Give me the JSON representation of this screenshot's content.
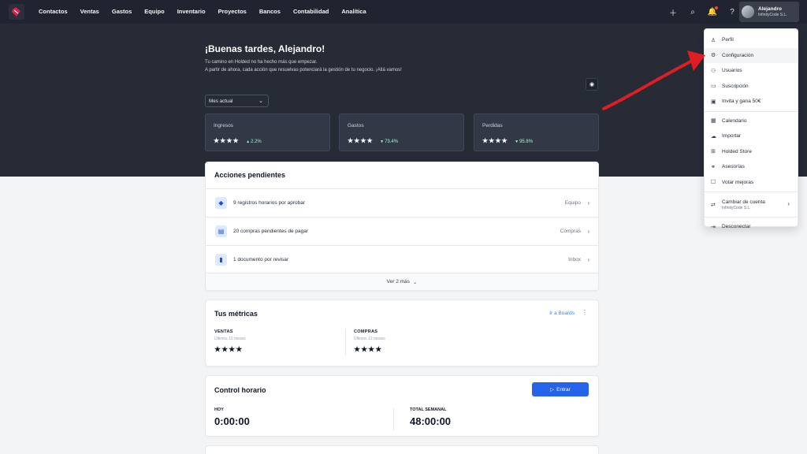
{
  "nav": {
    "items": [
      "Contactos",
      "Ventas",
      "Gastos",
      "Equipo",
      "Inventario",
      "Proyectos",
      "Bancos",
      "Contabilidad",
      "Analítica"
    ]
  },
  "user": {
    "name": "Alejandro",
    "company": "InfinityCode S.L."
  },
  "hero": {
    "greeting": "¡Buenas tardes, Alejandro!",
    "line1": "Tu camino en Holded no ha hecho más que empezar.",
    "line2": "A partir de ahora, cada acción que resuelvas potenciará la gestión de tu negocio. ¡Allá vamos!",
    "period": "Mes actual",
    "kpis": [
      {
        "label": "Ingresos",
        "value": "★★★★",
        "change": "2.2%",
        "direction": "up"
      },
      {
        "label": "Gastos",
        "value": "★★★★",
        "change": "73.4%",
        "direction": "down"
      },
      {
        "label": "Perdidas",
        "value": "★★★★",
        "change": "95.8%",
        "direction": "down"
      }
    ]
  },
  "pending": {
    "title": "Acciones pendientes",
    "rows": [
      {
        "text": "9 registros horarios por aprobar",
        "target": "Equipo"
      },
      {
        "text": "20 compras pendientes de pagar",
        "target": "Compras"
      },
      {
        "text": "1 documento por revisar",
        "target": "Inbox"
      }
    ],
    "more": "Ver 2 más"
  },
  "metrics": {
    "title": "Tus métricas",
    "boards": "Ir a Boards",
    "items": [
      {
        "name": "VENTAS",
        "sub": "Últimos 12 meses",
        "value": "★★★★"
      },
      {
        "name": "COMPRAS",
        "sub": "Últimos 12 meses",
        "value": "★★★★"
      }
    ]
  },
  "control": {
    "title": "Control horario",
    "enter": "Entrar",
    "today_label": "HOY",
    "today": "0:00:00",
    "week_label": "TOTAL SEMANAL",
    "week": "48:00:00"
  },
  "menu": {
    "items": [
      "Perfil",
      "Configuración",
      "Usuarios",
      "Suscripción",
      "Invita y gana 50€",
      "Calendario",
      "Importar",
      "Holded Store",
      "Asesorías",
      "Votar mejoras"
    ],
    "switch": "Cambiar de cuenta",
    "switch_sub": "InfinityCode S.L.",
    "logout": "Desconectar"
  },
  "colors": {
    "brand": "#e11d48",
    "topbar": "#1f2430",
    "primary": "#2563eb",
    "annotation": "#e11d24"
  }
}
